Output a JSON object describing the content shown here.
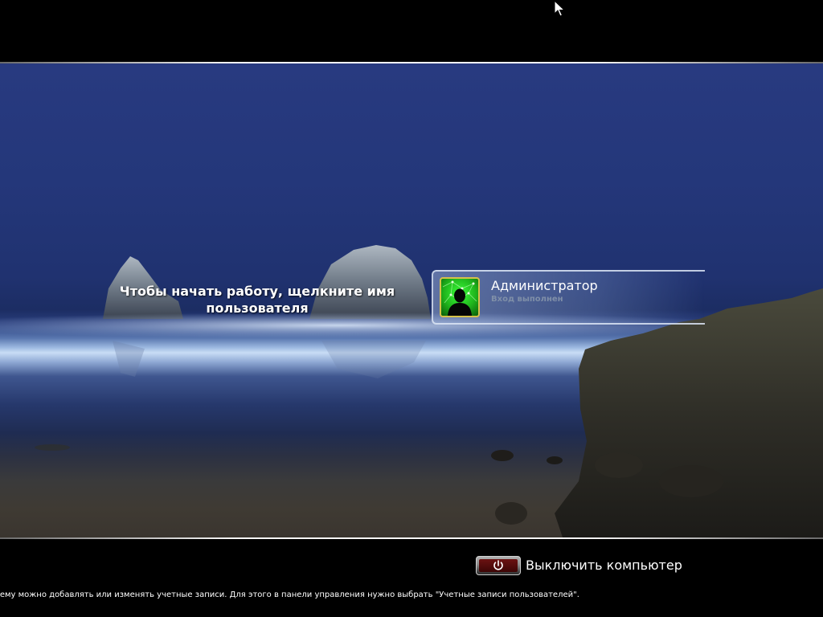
{
  "welcome": {
    "message": "Чтобы начать работу, щелкните имя пользователя"
  },
  "user_tile": {
    "name": "Администратор",
    "status": "Вход выполнен",
    "avatar_icon": "user-silhouette-icon",
    "avatar_color": "#2bd628"
  },
  "shutdown": {
    "label": "Выключить компьютер",
    "icon": "power-icon",
    "button_color": "#5a0b0b"
  },
  "footer": {
    "hint": "тему можно добавлять или изменять учетные записи. Для этого в панели управления нужно выбрать \"Учетные записи пользователей\"."
  },
  "cursor": {
    "icon": "mouse-pointer-icon"
  }
}
